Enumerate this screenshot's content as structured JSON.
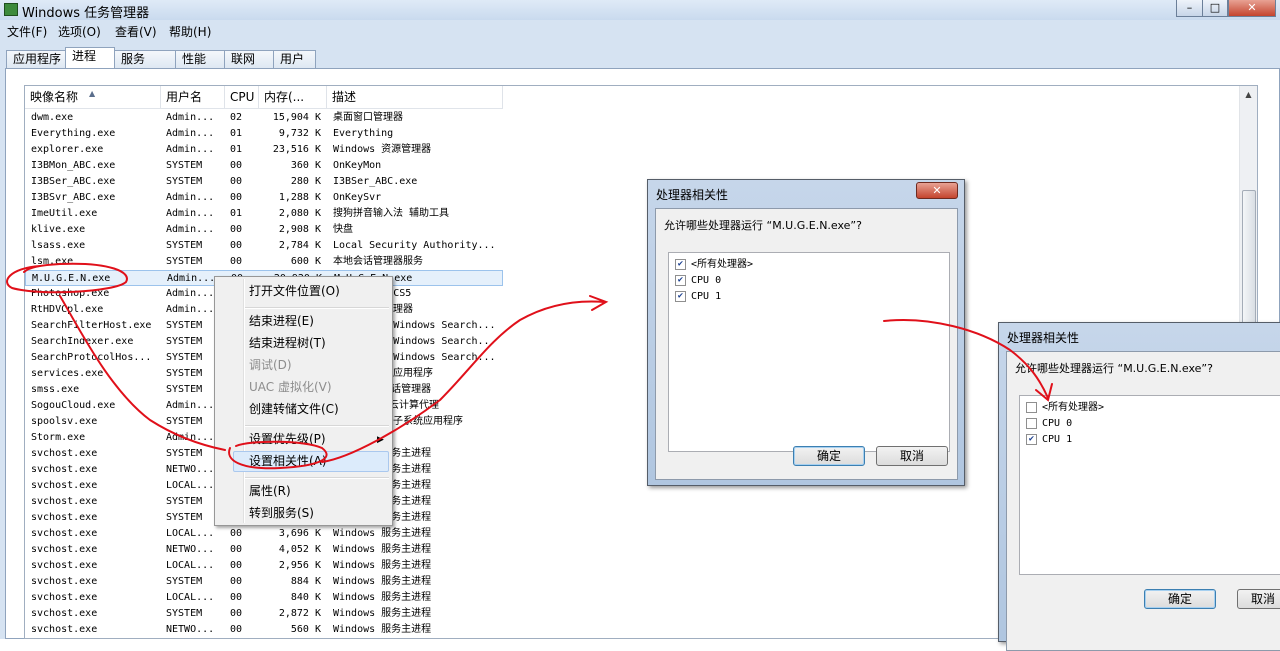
{
  "window": {
    "title": "Windows 任务管理器",
    "controls": [
      "–",
      "□",
      "✕"
    ]
  },
  "menubar": [
    "文件(F)",
    "选项(O)",
    "查看(V)",
    "帮助(H)"
  ],
  "tabs": [
    "应用程序",
    "进程",
    "服务",
    "性能",
    "联网",
    "用户"
  ],
  "active_tab": "进程",
  "columns": {
    "name": "映像名称",
    "user": "用户名",
    "cpu": "CPU",
    "mem": "内存(...",
    "desc": "描述"
  },
  "processes": [
    {
      "name": "dwm.exe",
      "user": "Admin...",
      "cpu": "02",
      "mem": "15,904 K",
      "desc": "桌面窗口管理器"
    },
    {
      "name": "Everything.exe",
      "user": "Admin...",
      "cpu": "01",
      "mem": "9,732 K",
      "desc": "Everything"
    },
    {
      "name": "explorer.exe",
      "user": "Admin...",
      "cpu": "01",
      "mem": "23,516 K",
      "desc": "Windows 资源管理器"
    },
    {
      "name": "I3BMon_ABC.exe",
      "user": "SYSTEM",
      "cpu": "00",
      "mem": "360 K",
      "desc": "OnKeyMon"
    },
    {
      "name": "I3BSer_ABC.exe",
      "user": "SYSTEM",
      "cpu": "00",
      "mem": "280 K",
      "desc": "I3BSer_ABC.exe"
    },
    {
      "name": "I3BSvr_ABC.exe",
      "user": "Admin...",
      "cpu": "00",
      "mem": "1,288 K",
      "desc": "OnKeySvr"
    },
    {
      "name": "ImeUtil.exe",
      "user": "Admin...",
      "cpu": "01",
      "mem": "2,080 K",
      "desc": "搜狗拼音输入法 辅助工具"
    },
    {
      "name": "klive.exe",
      "user": "Admin...",
      "cpu": "00",
      "mem": "2,908 K",
      "desc": "快盘"
    },
    {
      "name": "lsass.exe",
      "user": "SYSTEM",
      "cpu": "00",
      "mem": "2,784 K",
      "desc": "Local Security Authority..."
    },
    {
      "name": "lsm.exe",
      "user": "SYSTEM",
      "cpu": "00",
      "mem": "600 K",
      "desc": "本地会话管理器服务"
    },
    {
      "name": "M.U.G.E.N.exe",
      "user": "Admin...",
      "cpu": "00",
      "mem": "20,920 K",
      "desc": "M.U.G.E.N.exe"
    },
    {
      "name": "Photoshop.exe",
      "user": "Admin...",
      "cpu": "",
      "mem": "",
      "desc": "Photoshop CS5"
    },
    {
      "name": "RtHDVCpl.exe",
      "user": "Admin...",
      "cpu": "",
      "mem": "",
      "desc": "高清晰音频管理器"
    },
    {
      "name": "SearchFilterHost.exe",
      "user": "SYSTEM",
      "cpu": "",
      "mem": "",
      "desc": "Microsoft Windows Search..."
    },
    {
      "name": "SearchIndexer.exe",
      "user": "SYSTEM",
      "cpu": "",
      "mem": "",
      "desc": "Microsoft Windows Search..."
    },
    {
      "name": "SearchProtocolHos...",
      "user": "SYSTEM",
      "cpu": "",
      "mem": "",
      "desc": "Microsoft Windows Search..."
    },
    {
      "name": "services.exe",
      "user": "SYSTEM",
      "cpu": "",
      "mem": "",
      "desc": "服务和控制器应用程序"
    },
    {
      "name": "smss.exe",
      "user": "SYSTEM",
      "cpu": "",
      "mem": "",
      "desc": "Windows 会话管理器"
    },
    {
      "name": "SogouCloud.exe",
      "user": "Admin...",
      "cpu": "",
      "mem": "",
      "desc": "搜狗输入法 云计算代理"
    },
    {
      "name": "spoolsv.exe",
      "user": "SYSTEM",
      "cpu": "",
      "mem": "",
      "desc": "后台处理程序子系统应用程序"
    },
    {
      "name": "Storm.exe",
      "user": "Admin...",
      "cpu": "",
      "mem": "",
      "desc": ""
    },
    {
      "name": "svchost.exe",
      "user": "SYSTEM",
      "cpu": "",
      "mem": "",
      "desc": "Windows 服务主进程"
    },
    {
      "name": "svchost.exe",
      "user": "NETWO...",
      "cpu": "",
      "mem": "",
      "desc": "Windows 服务主进程"
    },
    {
      "name": "svchost.exe",
      "user": "LOCAL...",
      "cpu": "",
      "mem": "",
      "desc": "Windows 服务主进程"
    },
    {
      "name": "svchost.exe",
      "user": "SYSTEM",
      "cpu": "",
      "mem": "",
      "desc": "Windows 服务主进程"
    },
    {
      "name": "svchost.exe",
      "user": "SYSTEM",
      "cpu": "",
      "mem": "",
      "desc": "Windows 服务主进程"
    },
    {
      "name": "svchost.exe",
      "user": "LOCAL...",
      "cpu": "00",
      "mem": "3,696 K",
      "desc": "Windows 服务主进程"
    },
    {
      "name": "svchost.exe",
      "user": "NETWO...",
      "cpu": "00",
      "mem": "4,052 K",
      "desc": "Windows 服务主进程"
    },
    {
      "name": "svchost.exe",
      "user": "LOCAL...",
      "cpu": "00",
      "mem": "2,956 K",
      "desc": "Windows 服务主进程"
    },
    {
      "name": "svchost.exe",
      "user": "SYSTEM",
      "cpu": "00",
      "mem": "884 K",
      "desc": "Windows 服务主进程"
    },
    {
      "name": "svchost.exe",
      "user": "LOCAL...",
      "cpu": "00",
      "mem": "840 K",
      "desc": "Windows 服务主进程"
    },
    {
      "name": "svchost.exe",
      "user": "SYSTEM",
      "cpu": "00",
      "mem": "2,872 K",
      "desc": "Windows 服务主进程"
    },
    {
      "name": "svchost.exe",
      "user": "NETWO...",
      "cpu": "00",
      "mem": "560 K",
      "desc": "Windows 服务主进程"
    }
  ],
  "selected_process": "M.U.G.E.N.exe",
  "context_menu": {
    "items": [
      "打开文件位置(O)",
      "结束进程(E)",
      "结束进程树(T)",
      "调试(D)",
      "UAC 虚拟化(V)",
      "创建转储文件(C)",
      "设置优先级(P)",
      "设置相关性(A)",
      "属性(R)",
      "转到服务(S)"
    ],
    "disabled": [
      "调试(D)",
      "UAC 虚拟化(V)"
    ],
    "highlighted": "设置相关性(A)"
  },
  "affinity_dialog_1": {
    "title": "处理器相关性",
    "prompt": "允许哪些处理器运行 “M.U.G.E.N.exe”?",
    "options": [
      {
        "label": "<所有处理器>",
        "checked": true
      },
      {
        "label": "CPU 0",
        "checked": true
      },
      {
        "label": "CPU 1",
        "checked": true
      }
    ],
    "ok": "确定",
    "cancel": "取消",
    "close": "✕"
  },
  "affinity_dialog_2": {
    "title": "处理器相关性",
    "prompt": "允许哪些处理器运行 “M.U.G.E.N.exe”?",
    "options": [
      {
        "label": "<所有处理器>",
        "checked": false
      },
      {
        "label": "CPU 0",
        "checked": false
      },
      {
        "label": "CPU 1",
        "checked": true
      }
    ],
    "ok": "确定",
    "cancel": "取消"
  },
  "colors": {
    "annotation": "#e0101a",
    "title_bg": "#c9daee",
    "selection": "#e5f0fb"
  }
}
